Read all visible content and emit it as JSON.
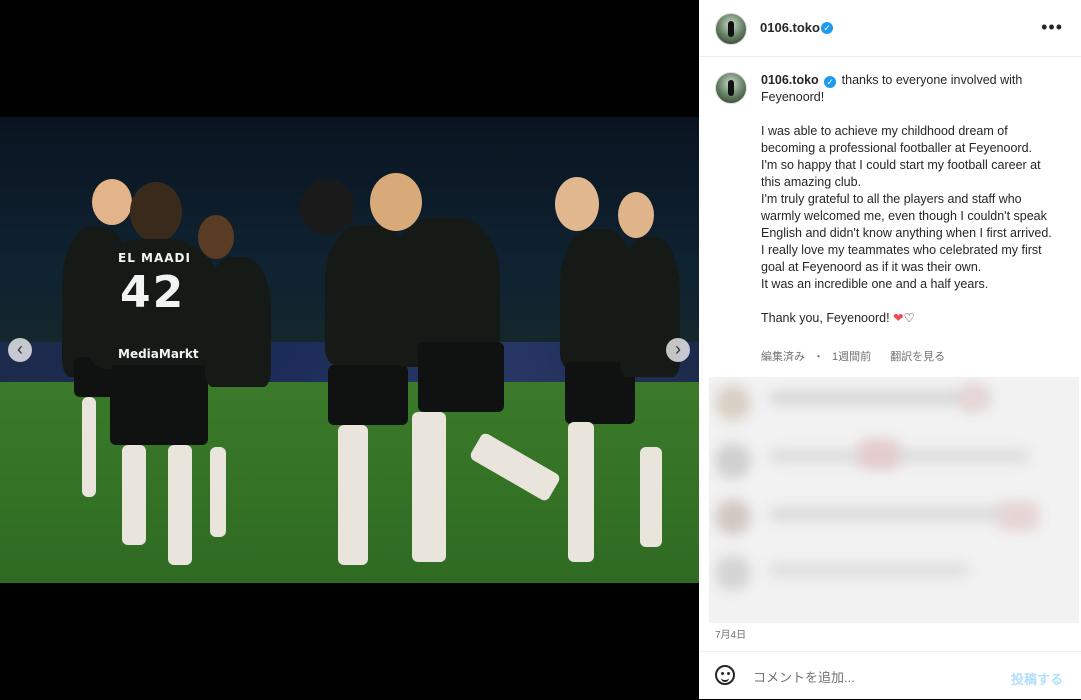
{
  "post": {
    "username": "0106.toko",
    "verified": true,
    "more_icon": "more-horizontal-icon"
  },
  "caption": {
    "username": "0106.toko",
    "first_line": "thanks to everyone involved with Feyenoord!",
    "paragraphs": [
      "I was able to achieve my childhood dream of becoming a professional footballer at Feyenoord.",
      "I'm so happy that I could start my football career at this amazing club.",
      "I'm truly grateful to all the players and staff who warmly welcomed me, even though I couldn't speak English and didn't know anything when I first arrived.",
      "I really love my teammates who celebrated my first goal at Feyenoord as if it was their own.",
      "It was an incredible one and a half years."
    ],
    "closing": "Thank you, Feyenoord!",
    "closing_hearts": [
      "❤",
      "♡"
    ],
    "edited": "編集済み",
    "separator": "・",
    "time_ago": "1週間前",
    "translate": "翻訳を見る"
  },
  "photo": {
    "jersey_number": "42",
    "back_name": "EL MAADI",
    "sponsor": "MediaMarkt"
  },
  "date": "7月4日",
  "comment": {
    "placeholder": "コメントを追加...",
    "post_label": "投稿する"
  },
  "nav": {
    "prev": "‹",
    "next": "›"
  }
}
